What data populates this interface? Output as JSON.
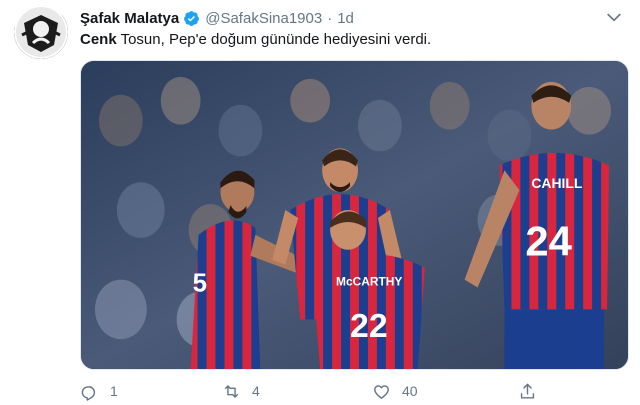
{
  "tweet": {
    "display_name": "Şafak Malatya",
    "handle": "@SafakSina1903",
    "separator": "·",
    "timestamp": "1d",
    "text_bold": "Cenk",
    "text_rest": " Tosun, Pep'e doğum gününde hediyesini verdi."
  },
  "photo": {
    "jersey_left_number": "5",
    "jersey_center_name": "McCARTHY",
    "jersey_center_number": "22",
    "jersey_right_name": "CAHILL",
    "jersey_right_number": "24",
    "colors": {
      "kit_red": "#d7263d",
      "kit_blue": "#1b3e8f"
    }
  },
  "actions": {
    "reply_count": "1",
    "retweet_count": "4",
    "like_count": "40"
  },
  "icons": {
    "verified": "verified-badge-icon",
    "caret": "chevron-down-icon",
    "reply": "reply-icon",
    "retweet": "retweet-icon",
    "like": "heart-icon",
    "share": "share-icon"
  },
  "colors": {
    "text": "#14171a",
    "muted": "#657786",
    "verified_blue": "#1da1f2"
  }
}
